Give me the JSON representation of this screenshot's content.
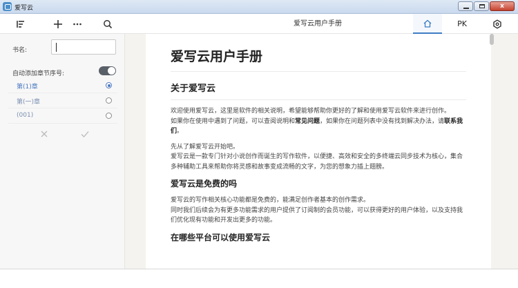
{
  "window": {
    "title": "爱写云",
    "min_label": "",
    "max_label": "",
    "close_label": "x"
  },
  "toolbar": {
    "doc_title": "爱写云用户手册",
    "pk_label": "PK"
  },
  "sidebar": {
    "bookname_label": "书名:",
    "bookname_value": "",
    "auto_number_label": "自动添加章节序号:",
    "auto_number_enabled": true,
    "chapter_formats": [
      {
        "label": "第(1)章",
        "selected": true
      },
      {
        "label": "第(一)章",
        "selected": false
      },
      {
        "label": "(001)",
        "selected": false
      }
    ]
  },
  "document": {
    "title": "爱写云用户手册",
    "sections": [
      {
        "heading": "关于爱写云",
        "level": 2,
        "paragraphs": [
          {
            "parts": [
              {
                "text": "欢迎使用爱写云，这里是软件的相关说明，希望能够帮助你更好的了解和使用爱写云软件来进行创作。",
                "bold": false
              },
              {
                "text": "\n如果你在使用中遇到了问题，可以查阅说明和",
                "bold": false
              },
              {
                "text": "常见问题",
                "bold": true
              },
              {
                "text": "，如果你在问题列表中没有找到解决办法，请",
                "bold": false
              },
              {
                "text": "联系我们",
                "bold": true
              },
              {
                "text": "。",
                "bold": false
              }
            ]
          },
          {
            "parts": [
              {
                "text": "先从了解爱写云开始吧。\n爱写云是一款专门针对小说创作而诞生的写作软件，以便捷、高效和安全的多终端云同步技术为核心，集合多种辅助工具来帮助你将灵感和故事变成流畅的文字，为您的想象力插上翅膀。",
                "bold": false
              }
            ]
          }
        ]
      },
      {
        "heading": "爱写云是免费的吗",
        "level": 3,
        "paragraphs": [
          {
            "parts": [
              {
                "text": "爱写云的写作相关核心功能都是免费的，能满足创作者基本的创作需求。\n同时我们后续会为有更多功能需求的用户提供了订阅制的会员功能，可以获得更好的用户体验，以及支持我们优化现有功能和开发出更多的功能。",
                "bold": false
              }
            ]
          }
        ]
      },
      {
        "heading": "在哪些平台可以使用爱写云",
        "level": 3,
        "paragraphs": []
      }
    ]
  },
  "colors": {
    "accent": "#3d7cc4",
    "sidebar_bg": "#f7f7f7",
    "main_bg": "#f5f3ef"
  }
}
